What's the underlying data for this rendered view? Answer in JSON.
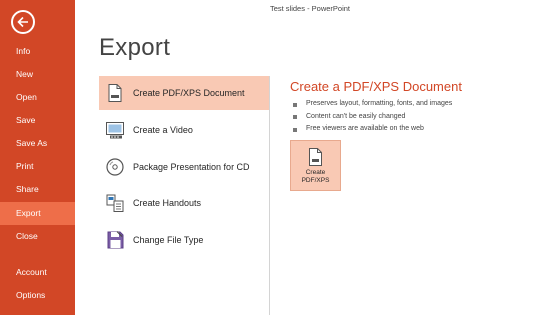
{
  "window": {
    "title": "Test slides - PowerPoint"
  },
  "sidebar": {
    "back_icon": "back-arrow-icon",
    "items": [
      {
        "label": "Info",
        "active": false
      },
      {
        "label": "New",
        "active": false
      },
      {
        "label": "Open",
        "active": false
      },
      {
        "label": "Save",
        "active": false
      },
      {
        "label": "Save As",
        "active": false
      },
      {
        "label": "Print",
        "active": false
      },
      {
        "label": "Share",
        "active": false
      },
      {
        "label": "Export",
        "active": true
      },
      {
        "label": "Close",
        "active": false
      },
      {
        "label": "Account",
        "active": false
      },
      {
        "label": "Options",
        "active": false
      }
    ]
  },
  "main": {
    "title": "Export",
    "options": [
      {
        "label": "Create PDF/XPS Document",
        "icon": "pdf-document-icon",
        "selected": true
      },
      {
        "label": "Create a Video",
        "icon": "video-icon",
        "selected": false
      },
      {
        "label": "Package Presentation for CD",
        "icon": "cd-package-icon",
        "selected": false
      },
      {
        "label": "Create Handouts",
        "icon": "handouts-icon",
        "selected": false
      },
      {
        "label": "Change File Type",
        "icon": "file-type-icon",
        "selected": false
      }
    ]
  },
  "detail": {
    "title": "Create a PDF/XPS Document",
    "bullets": [
      "Preserves layout, formatting, fonts, and images",
      "Content can't be easily changed",
      "Free viewers are available on the web"
    ],
    "button": {
      "line1": "Create",
      "line2": "PDF/XPS",
      "icon": "pdf-document-icon"
    }
  },
  "colors": {
    "accent": "#d24726",
    "active_nav": "#ee6e49",
    "selected": "#f9c9b4"
  }
}
